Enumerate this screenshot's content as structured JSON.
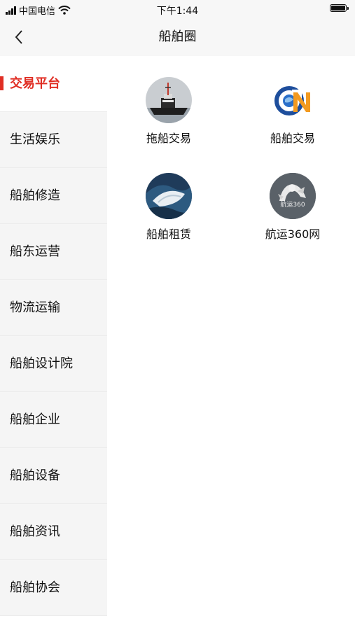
{
  "status": {
    "carrier": "中国电信",
    "time": "下午1:44"
  },
  "navbar": {
    "title": "船舶圈"
  },
  "sidebar": {
    "items": [
      {
        "label": "交易平台",
        "active": true
      },
      {
        "label": "生活娱乐",
        "active": false
      },
      {
        "label": "船舶修造",
        "active": false
      },
      {
        "label": "船东运营",
        "active": false
      },
      {
        "label": "物流运输",
        "active": false
      },
      {
        "label": "船舶设计院",
        "active": false
      },
      {
        "label": "船舶企业",
        "active": false
      },
      {
        "label": "船舶设备",
        "active": false
      },
      {
        "label": "船舶资讯",
        "active": false
      },
      {
        "label": "船舶协会",
        "active": false
      }
    ]
  },
  "grid": {
    "items": [
      {
        "label": "拖船交易",
        "icon": "tugboat-photo-icon"
      },
      {
        "label": "船舶交易",
        "icon": "cn-logo-icon"
      },
      {
        "label": "船舶租赁",
        "icon": "ship-wave-photo-icon"
      },
      {
        "label": "航运360网",
        "icon": "hangyun360-logo-icon",
        "logo_text": "航运360"
      }
    ]
  },
  "colors": {
    "accent": "#e02e24",
    "sidebar_bg": "#f5f5f5",
    "nav_bg": "#f7f7f7"
  }
}
